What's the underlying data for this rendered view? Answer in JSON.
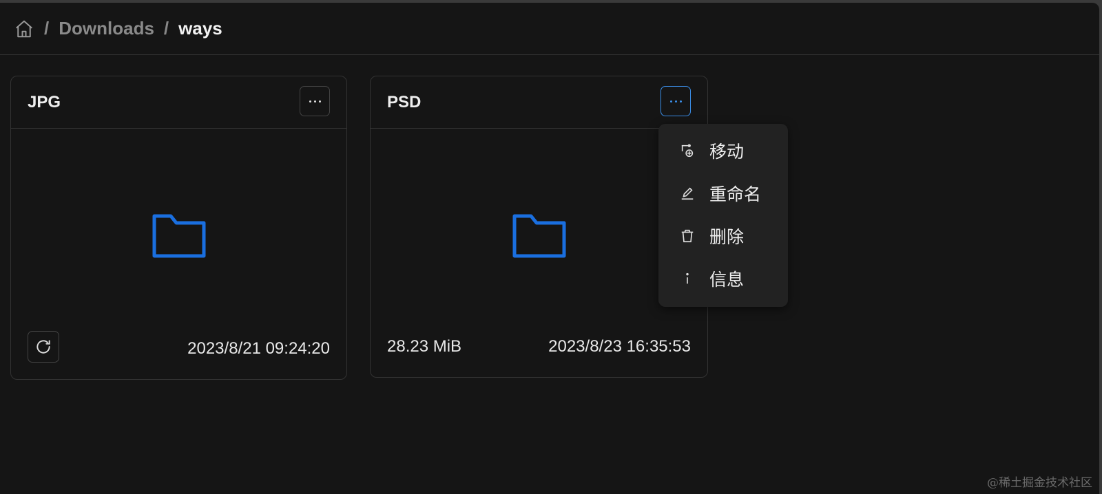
{
  "breadcrumb": {
    "home_icon": "home-icon",
    "items": [
      "Downloads",
      "ways"
    ],
    "separator": "/"
  },
  "cards": [
    {
      "title": "JPG",
      "date": "2023/8/21 09:24:20",
      "icon": "folder-icon"
    },
    {
      "title": "PSD",
      "size": "28.23 MiB",
      "date": "2023/8/23 16:35:53",
      "icon": "folder-icon"
    }
  ],
  "context_menu": {
    "items": [
      {
        "label": "移动",
        "icon": "move-icon"
      },
      {
        "label": "重命名",
        "icon": "pencil-icon"
      },
      {
        "label": "删除",
        "icon": "trash-icon"
      },
      {
        "label": "信息",
        "icon": "info-icon"
      }
    ]
  },
  "watermark": "@稀土掘金技术社区",
  "colors": {
    "accent": "#1a6fe0",
    "background": "#151515"
  }
}
